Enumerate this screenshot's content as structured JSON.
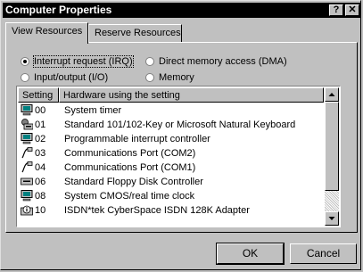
{
  "window": {
    "title": "Computer Properties",
    "help_button": "?",
    "close_button": "✕"
  },
  "tabs": [
    {
      "label": "View Resources"
    },
    {
      "label": "Reserve Resources"
    }
  ],
  "radios": [
    {
      "label": "Interrupt request (IRQ)",
      "checked": true
    },
    {
      "label": "Input/output (I/O)",
      "checked": false
    },
    {
      "label": "Direct memory access (DMA)",
      "checked": false
    },
    {
      "label": "Memory",
      "checked": false
    }
  ],
  "list": {
    "columns": [
      "Setting",
      "Hardware using the setting"
    ],
    "rows": [
      {
        "icon": "computer-icon",
        "setting": "00",
        "hardware": "System timer"
      },
      {
        "icon": "keyboard-icon",
        "setting": "01",
        "hardware": "Standard 101/102-Key or Microsoft Natural Keyboard"
      },
      {
        "icon": "computer-icon",
        "setting": "02",
        "hardware": "Programmable interrupt controller"
      },
      {
        "icon": "port-icon",
        "setting": "03",
        "hardware": "Communications Port (COM2)"
      },
      {
        "icon": "port-icon",
        "setting": "04",
        "hardware": "Communications Port (COM1)"
      },
      {
        "icon": "floppy-drive-icon",
        "setting": "06",
        "hardware": "Standard Floppy Disk Controller"
      },
      {
        "icon": "computer-icon",
        "setting": "08",
        "hardware": "System CMOS/real time clock"
      },
      {
        "icon": "isdn-adapter-icon",
        "setting": "10",
        "hardware": "ISDN*tek CyberSpace ISDN 128K Adapter"
      }
    ]
  },
  "buttons": {
    "ok": "OK",
    "cancel": "Cancel"
  }
}
